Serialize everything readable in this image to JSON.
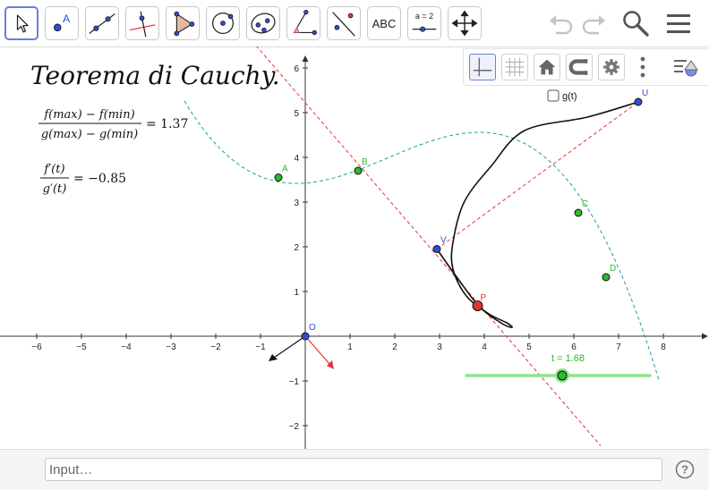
{
  "toolbar": {
    "tools": [
      {
        "name": "move-tool"
      },
      {
        "name": "point-tool",
        "label": "A"
      },
      {
        "name": "line-tool"
      },
      {
        "name": "perpendicular-line-tool"
      },
      {
        "name": "polygon-tool"
      },
      {
        "name": "circle-tool"
      },
      {
        "name": "ellipse-tool"
      },
      {
        "name": "angle-tool"
      },
      {
        "name": "reflect-tool"
      },
      {
        "name": "text-tool",
        "label": "ABC"
      },
      {
        "name": "slider-tool",
        "label": "a = 2"
      },
      {
        "name": "move-graphics-tool"
      }
    ],
    "right_icons": [
      "undo-icon",
      "redo-icon",
      "search-icon",
      "menu-icon"
    ]
  },
  "stylebar": {
    "buttons": [
      "axes-icon",
      "grid-icon",
      "home-icon",
      "magnet-icon",
      "gear-icon",
      "more-icon",
      "style-bar-toggle-icon"
    ]
  },
  "graphics": {
    "title": "Teorema di Cauchy.",
    "formula1": {
      "numerator": "f(max) − f(min)",
      "denominator": "g(max) − g(min)",
      "result": "= 1.37"
    },
    "formula2": {
      "numerator": "f′(t)",
      "denominator": "g′(t)",
      "result": "= −0.85"
    },
    "checkbox_label": "g(t)",
    "x_ticks": [
      "−6",
      "−5",
      "−4",
      "−3",
      "−2",
      "−1",
      "1",
      "2",
      "3",
      "4",
      "5",
      "6",
      "7",
      "8"
    ],
    "y_ticks": [
      "6",
      "5",
      "4",
      "3",
      "2",
      "1",
      "−1",
      "−2"
    ],
    "points": {
      "O": {
        "label": "O",
        "x": 0,
        "y": 0,
        "color": "#2f4fd6"
      },
      "A": {
        "label": "A",
        "x": -0.6,
        "y": 3.55,
        "color": "#2eb82e"
      },
      "B": {
        "label": "B",
        "x": 1.18,
        "y": 3.7,
        "color": "#2eb82e"
      },
      "C": {
        "label": "C",
        "x": 6.1,
        "y": 2.76,
        "color": "#2eb82e"
      },
      "D": {
        "label": "D",
        "x": 6.72,
        "y": 1.32,
        "color": "#2eb82e"
      },
      "U": {
        "label": "U",
        "x": 7.44,
        "y": 5.24,
        "color": "#2f4fd6"
      },
      "V": {
        "label": "V",
        "x": 2.94,
        "y": 1.95,
        "color": "#2f4fd6"
      },
      "P": {
        "label": "P",
        "x": 3.85,
        "y": 0.68,
        "color": "#e3343a"
      }
    },
    "slider": {
      "label": "t = 1.68",
      "min_x": 3.6,
      "max_x": 7.7,
      "y": -0.88,
      "value_x": 5.74,
      "color": "#2eb82e"
    }
  },
  "inputbar": {
    "placeholder": "Input…"
  },
  "colors": {
    "accent": "#6b7fd6",
    "curve_f": "#1f9ea0",
    "dashed_red": "#e3343a",
    "green": "#2eb82e",
    "blue": "#2f4fd6"
  }
}
